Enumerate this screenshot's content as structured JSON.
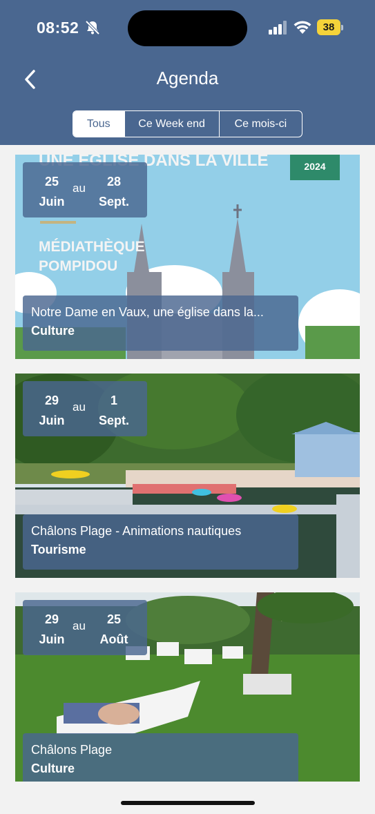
{
  "status_bar": {
    "time": "08:52",
    "battery": "38"
  },
  "header": {
    "title": "Agenda"
  },
  "filters": [
    {
      "label": "Tous",
      "active": true
    },
    {
      "label": "Ce Week end",
      "active": false
    },
    {
      "label": "Ce mois-ci",
      "active": false
    }
  ],
  "events": [
    {
      "start_day": "25",
      "start_month": "Juin",
      "separator": "au",
      "end_day": "28",
      "end_month": "Sept.",
      "title": "Notre Dame en Vaux, une église dans la...",
      "category": "Culture",
      "poster": {
        "headline": "UNE EGLISE DANS LA VILLE",
        "venue_line1": "MÉDIATHÈQUE",
        "venue_line2": "POMPIDOU",
        "year": "2024"
      }
    },
    {
      "start_day": "29",
      "start_month": "Juin",
      "separator": "au",
      "end_day": "1",
      "end_month": "Sept.",
      "title": "Châlons Plage - Animations nautiques",
      "category": "Tourisme"
    },
    {
      "start_day": "29",
      "start_month": "Juin",
      "separator": "au",
      "end_day": "25",
      "end_month": "Août",
      "title": "Châlons Plage",
      "category": "Culture"
    }
  ]
}
